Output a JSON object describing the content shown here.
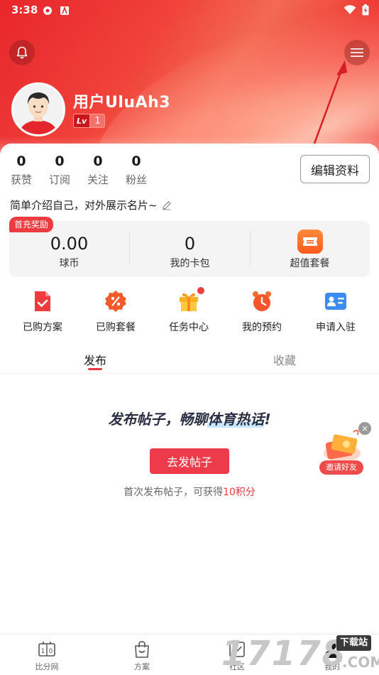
{
  "status_bar": {
    "time": "3:38"
  },
  "profile": {
    "username": "用户UluAh3",
    "level_prefix": "Lv",
    "level": "1"
  },
  "stats": [
    {
      "value": "0",
      "label": "获赞"
    },
    {
      "value": "0",
      "label": "订阅"
    },
    {
      "value": "0",
      "label": "关注"
    },
    {
      "value": "0",
      "label": "粉丝"
    }
  ],
  "edit_profile_label": "编辑资料",
  "bio": "简单介绍自己，对外展示名片~",
  "wallet": {
    "tag": "首充奖励",
    "coins_value": "0.00",
    "coins_label": "球币",
    "cards_value": "0",
    "cards_label": "我的卡包",
    "package_label": "超值套餐"
  },
  "shortcuts": [
    {
      "label": "已购方案",
      "icon": "document-check-icon"
    },
    {
      "label": "已购套餐",
      "icon": "discount-badge-icon"
    },
    {
      "label": "任务中心",
      "icon": "gift-icon"
    },
    {
      "label": "我的预约",
      "icon": "alarm-clock-icon"
    },
    {
      "label": "申请入驻",
      "icon": "id-card-icon"
    }
  ],
  "tabs": {
    "publish": "发布",
    "favorites": "收藏"
  },
  "empty_state": {
    "title_part1": "发布帖子，畅聊",
    "title_highlight": "体育热话",
    "title_part2": "!",
    "button": "去发帖子",
    "hint_prefix": "首次发布帖子，可获得",
    "hint_points": "10积分"
  },
  "invite": {
    "label": "邀请好友",
    "close": "×"
  },
  "bottom_nav": [
    {
      "label": "比分网",
      "icon": "scoreboard-icon"
    },
    {
      "label": "方案",
      "icon": "shopping-bag-icon"
    },
    {
      "label": "社区",
      "icon": "community-icon"
    },
    {
      "label": "我的",
      "icon": "user-icon"
    }
  ],
  "watermark": {
    "big": "17178",
    "tag": "下载站",
    "com": ".COM"
  },
  "colors": {
    "brand_red": "#ee3b40",
    "header_red": "#e8262a"
  }
}
